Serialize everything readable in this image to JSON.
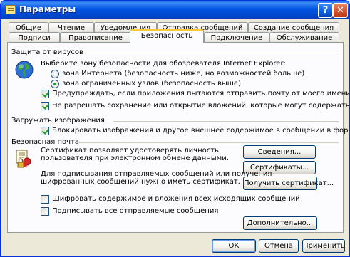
{
  "window": {
    "title": "Параметры",
    "help_label": "?",
    "close_label": "✕"
  },
  "tabs_row1": [
    {
      "label": "Общие"
    },
    {
      "label": "Чтение"
    },
    {
      "label": "Уведомления"
    },
    {
      "label": "Отправка сообщений"
    },
    {
      "label": "Создание сообщения"
    }
  ],
  "tabs_row2": [
    {
      "label": "Подписи"
    },
    {
      "label": "Правописание"
    },
    {
      "label": "Безопасность",
      "active": true
    },
    {
      "label": "Подключение"
    },
    {
      "label": "Обслуживание"
    }
  ],
  "virus": {
    "heading": "Защита от вирусов",
    "zone_label": "Выберите зону безопасности для обозревателя Internet Explorer:",
    "zone_internet": "зона Интернета (безопасность ниже, но возможностей больше)",
    "zone_restricted": "зона ограниченных узлов (безопасность выше)",
    "warn_label": "Предупреждать, если приложения пытаются отправить почту от моего имени.",
    "block_attach_label": "Не разрешать сохранение или открытие вложений, которые могут содержать вирусы.",
    "selected_zone": "restricted",
    "warn_checked": true,
    "block_attach_checked": true
  },
  "images": {
    "heading": "Загружать изображения",
    "block_images_label": "Блокировать изображения и другое внешнее содержимое в сообщении в формате HTML.",
    "block_images_checked": true
  },
  "secure_mail": {
    "heading": "Безопасная почта",
    "cert_text_1": "Сертификат позволяет удостоверять личность",
    "cert_text_2": "пользователя при электронном обмене данными.",
    "sign_text_1": "Для подписывания отправляемых сообщений или получения",
    "sign_text_2": "шифрованных сообщений нужно иметь сертификат.",
    "btn_info": "Сведения...",
    "btn_certs": "Сертификаты...",
    "btn_get_cert": "Получить сертификат...",
    "encrypt_label": "Шифровать содержимое и вложения всех исходящих сообщений",
    "sign_label": "Подписывать все отправляемые сообщения",
    "encrypt_checked": false,
    "sign_checked": false,
    "btn_advanced": "Дополнительно..."
  },
  "footer": {
    "ok": "ОК",
    "cancel": "Отмена",
    "apply": "Применить"
  },
  "colors": {
    "title_blue": "#0054e3",
    "face": "#ece9d8",
    "tab_highlight": "#ffc83c",
    "check_green": "#21a121"
  }
}
